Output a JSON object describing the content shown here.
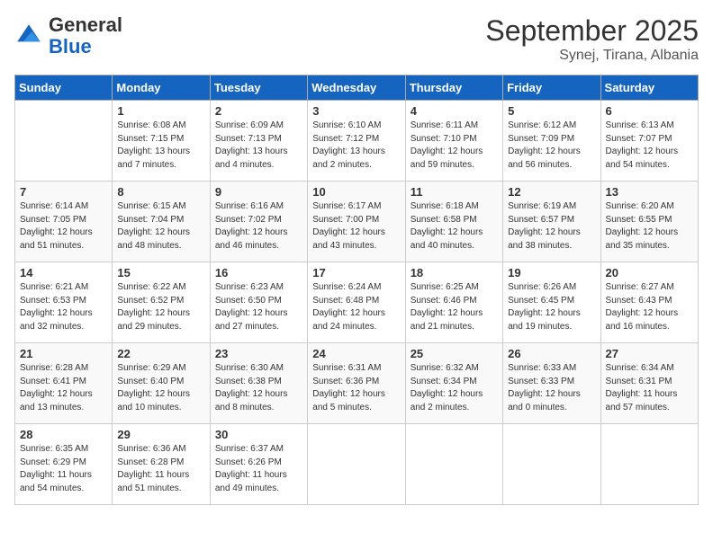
{
  "header": {
    "logo_general": "General",
    "logo_blue": "Blue",
    "month_title": "September 2025",
    "location": "Synej, Tirana, Albania"
  },
  "days_of_week": [
    "Sunday",
    "Monday",
    "Tuesday",
    "Wednesday",
    "Thursday",
    "Friday",
    "Saturday"
  ],
  "weeks": [
    [
      {
        "day": "",
        "info": ""
      },
      {
        "day": "1",
        "info": "Sunrise: 6:08 AM\nSunset: 7:15 PM\nDaylight: 13 hours\nand 7 minutes."
      },
      {
        "day": "2",
        "info": "Sunrise: 6:09 AM\nSunset: 7:13 PM\nDaylight: 13 hours\nand 4 minutes."
      },
      {
        "day": "3",
        "info": "Sunrise: 6:10 AM\nSunset: 7:12 PM\nDaylight: 13 hours\nand 2 minutes."
      },
      {
        "day": "4",
        "info": "Sunrise: 6:11 AM\nSunset: 7:10 PM\nDaylight: 12 hours\nand 59 minutes."
      },
      {
        "day": "5",
        "info": "Sunrise: 6:12 AM\nSunset: 7:09 PM\nDaylight: 12 hours\nand 56 minutes."
      },
      {
        "day": "6",
        "info": "Sunrise: 6:13 AM\nSunset: 7:07 PM\nDaylight: 12 hours\nand 54 minutes."
      }
    ],
    [
      {
        "day": "7",
        "info": "Sunrise: 6:14 AM\nSunset: 7:05 PM\nDaylight: 12 hours\nand 51 minutes."
      },
      {
        "day": "8",
        "info": "Sunrise: 6:15 AM\nSunset: 7:04 PM\nDaylight: 12 hours\nand 48 minutes."
      },
      {
        "day": "9",
        "info": "Sunrise: 6:16 AM\nSunset: 7:02 PM\nDaylight: 12 hours\nand 46 minutes."
      },
      {
        "day": "10",
        "info": "Sunrise: 6:17 AM\nSunset: 7:00 PM\nDaylight: 12 hours\nand 43 minutes."
      },
      {
        "day": "11",
        "info": "Sunrise: 6:18 AM\nSunset: 6:58 PM\nDaylight: 12 hours\nand 40 minutes."
      },
      {
        "day": "12",
        "info": "Sunrise: 6:19 AM\nSunset: 6:57 PM\nDaylight: 12 hours\nand 38 minutes."
      },
      {
        "day": "13",
        "info": "Sunrise: 6:20 AM\nSunset: 6:55 PM\nDaylight: 12 hours\nand 35 minutes."
      }
    ],
    [
      {
        "day": "14",
        "info": "Sunrise: 6:21 AM\nSunset: 6:53 PM\nDaylight: 12 hours\nand 32 minutes."
      },
      {
        "day": "15",
        "info": "Sunrise: 6:22 AM\nSunset: 6:52 PM\nDaylight: 12 hours\nand 29 minutes."
      },
      {
        "day": "16",
        "info": "Sunrise: 6:23 AM\nSunset: 6:50 PM\nDaylight: 12 hours\nand 27 minutes."
      },
      {
        "day": "17",
        "info": "Sunrise: 6:24 AM\nSunset: 6:48 PM\nDaylight: 12 hours\nand 24 minutes."
      },
      {
        "day": "18",
        "info": "Sunrise: 6:25 AM\nSunset: 6:46 PM\nDaylight: 12 hours\nand 21 minutes."
      },
      {
        "day": "19",
        "info": "Sunrise: 6:26 AM\nSunset: 6:45 PM\nDaylight: 12 hours\nand 19 minutes."
      },
      {
        "day": "20",
        "info": "Sunrise: 6:27 AM\nSunset: 6:43 PM\nDaylight: 12 hours\nand 16 minutes."
      }
    ],
    [
      {
        "day": "21",
        "info": "Sunrise: 6:28 AM\nSunset: 6:41 PM\nDaylight: 12 hours\nand 13 minutes."
      },
      {
        "day": "22",
        "info": "Sunrise: 6:29 AM\nSunset: 6:40 PM\nDaylight: 12 hours\nand 10 minutes."
      },
      {
        "day": "23",
        "info": "Sunrise: 6:30 AM\nSunset: 6:38 PM\nDaylight: 12 hours\nand 8 minutes."
      },
      {
        "day": "24",
        "info": "Sunrise: 6:31 AM\nSunset: 6:36 PM\nDaylight: 12 hours\nand 5 minutes."
      },
      {
        "day": "25",
        "info": "Sunrise: 6:32 AM\nSunset: 6:34 PM\nDaylight: 12 hours\nand 2 minutes."
      },
      {
        "day": "26",
        "info": "Sunrise: 6:33 AM\nSunset: 6:33 PM\nDaylight: 12 hours\nand 0 minutes."
      },
      {
        "day": "27",
        "info": "Sunrise: 6:34 AM\nSunset: 6:31 PM\nDaylight: 11 hours\nand 57 minutes."
      }
    ],
    [
      {
        "day": "28",
        "info": "Sunrise: 6:35 AM\nSunset: 6:29 PM\nDaylight: 11 hours\nand 54 minutes."
      },
      {
        "day": "29",
        "info": "Sunrise: 6:36 AM\nSunset: 6:28 PM\nDaylight: 11 hours\nand 51 minutes."
      },
      {
        "day": "30",
        "info": "Sunrise: 6:37 AM\nSunset: 6:26 PM\nDaylight: 11 hours\nand 49 minutes."
      },
      {
        "day": "",
        "info": ""
      },
      {
        "day": "",
        "info": ""
      },
      {
        "day": "",
        "info": ""
      },
      {
        "day": "",
        "info": ""
      }
    ]
  ]
}
